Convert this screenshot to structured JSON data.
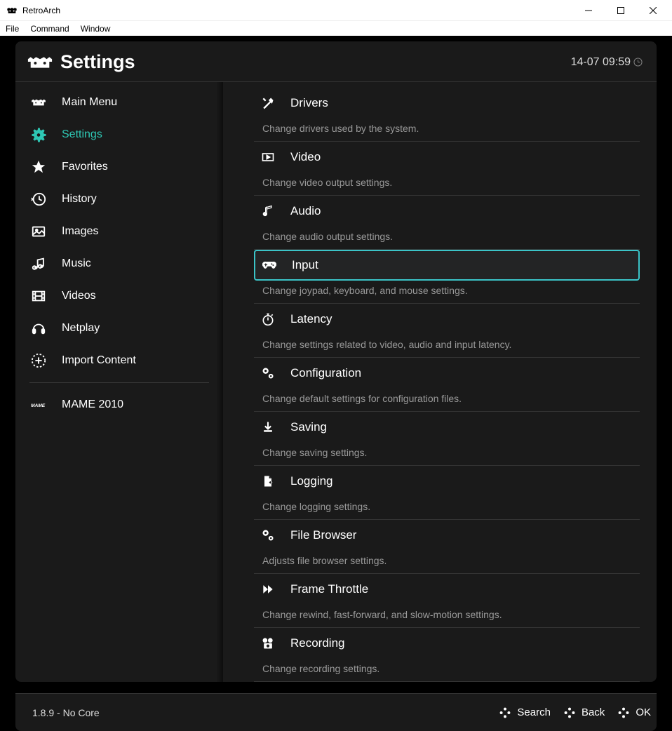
{
  "window": {
    "title": "RetroArch",
    "menus": [
      "File",
      "Command",
      "Window"
    ]
  },
  "header": {
    "title": "Settings",
    "datetime": "14-07 09:59"
  },
  "sidebar": {
    "items": [
      {
        "label": "Main Menu",
        "icon": "retroarch"
      },
      {
        "label": "Settings",
        "icon": "gear",
        "active": true
      },
      {
        "label": "Favorites",
        "icon": "star"
      },
      {
        "label": "History",
        "icon": "history"
      },
      {
        "label": "Images",
        "icon": "image"
      },
      {
        "label": "Music",
        "icon": "music"
      },
      {
        "label": "Videos",
        "icon": "film"
      },
      {
        "label": "Netplay",
        "icon": "headset"
      },
      {
        "label": "Import Content",
        "icon": "plus"
      }
    ],
    "extra": [
      {
        "label": "MAME 2010",
        "icon": "mame"
      }
    ]
  },
  "settings": [
    {
      "label": "Drivers",
      "desc": "Change drivers used by the system.",
      "icon": "tools"
    },
    {
      "label": "Video",
      "desc": "Change video output settings.",
      "icon": "video"
    },
    {
      "label": "Audio",
      "desc": "Change audio output settings.",
      "icon": "note"
    },
    {
      "label": "Input",
      "desc": "Change joypad, keyboard, and mouse settings.",
      "icon": "gamepad",
      "selected": true
    },
    {
      "label": "Latency",
      "desc": "Change settings related to video, audio and input latency.",
      "icon": "stopwatch"
    },
    {
      "label": "Configuration",
      "desc": "Change default settings for configuration files.",
      "icon": "cogs"
    },
    {
      "label": "Saving",
      "desc": "Change saving settings.",
      "icon": "download"
    },
    {
      "label": "Logging",
      "desc": "Change logging settings.",
      "icon": "file"
    },
    {
      "label": "File Browser",
      "desc": "Adjusts file browser settings.",
      "icon": "cogs"
    },
    {
      "label": "Frame Throttle",
      "desc": "Change rewind, fast-forward, and slow-motion settings.",
      "icon": "ff"
    },
    {
      "label": "Recording",
      "desc": "Change recording settings.",
      "icon": "record"
    }
  ],
  "footer": {
    "status": "1.8.9 - No Core",
    "actions": [
      "Search",
      "Back",
      "OK"
    ]
  }
}
